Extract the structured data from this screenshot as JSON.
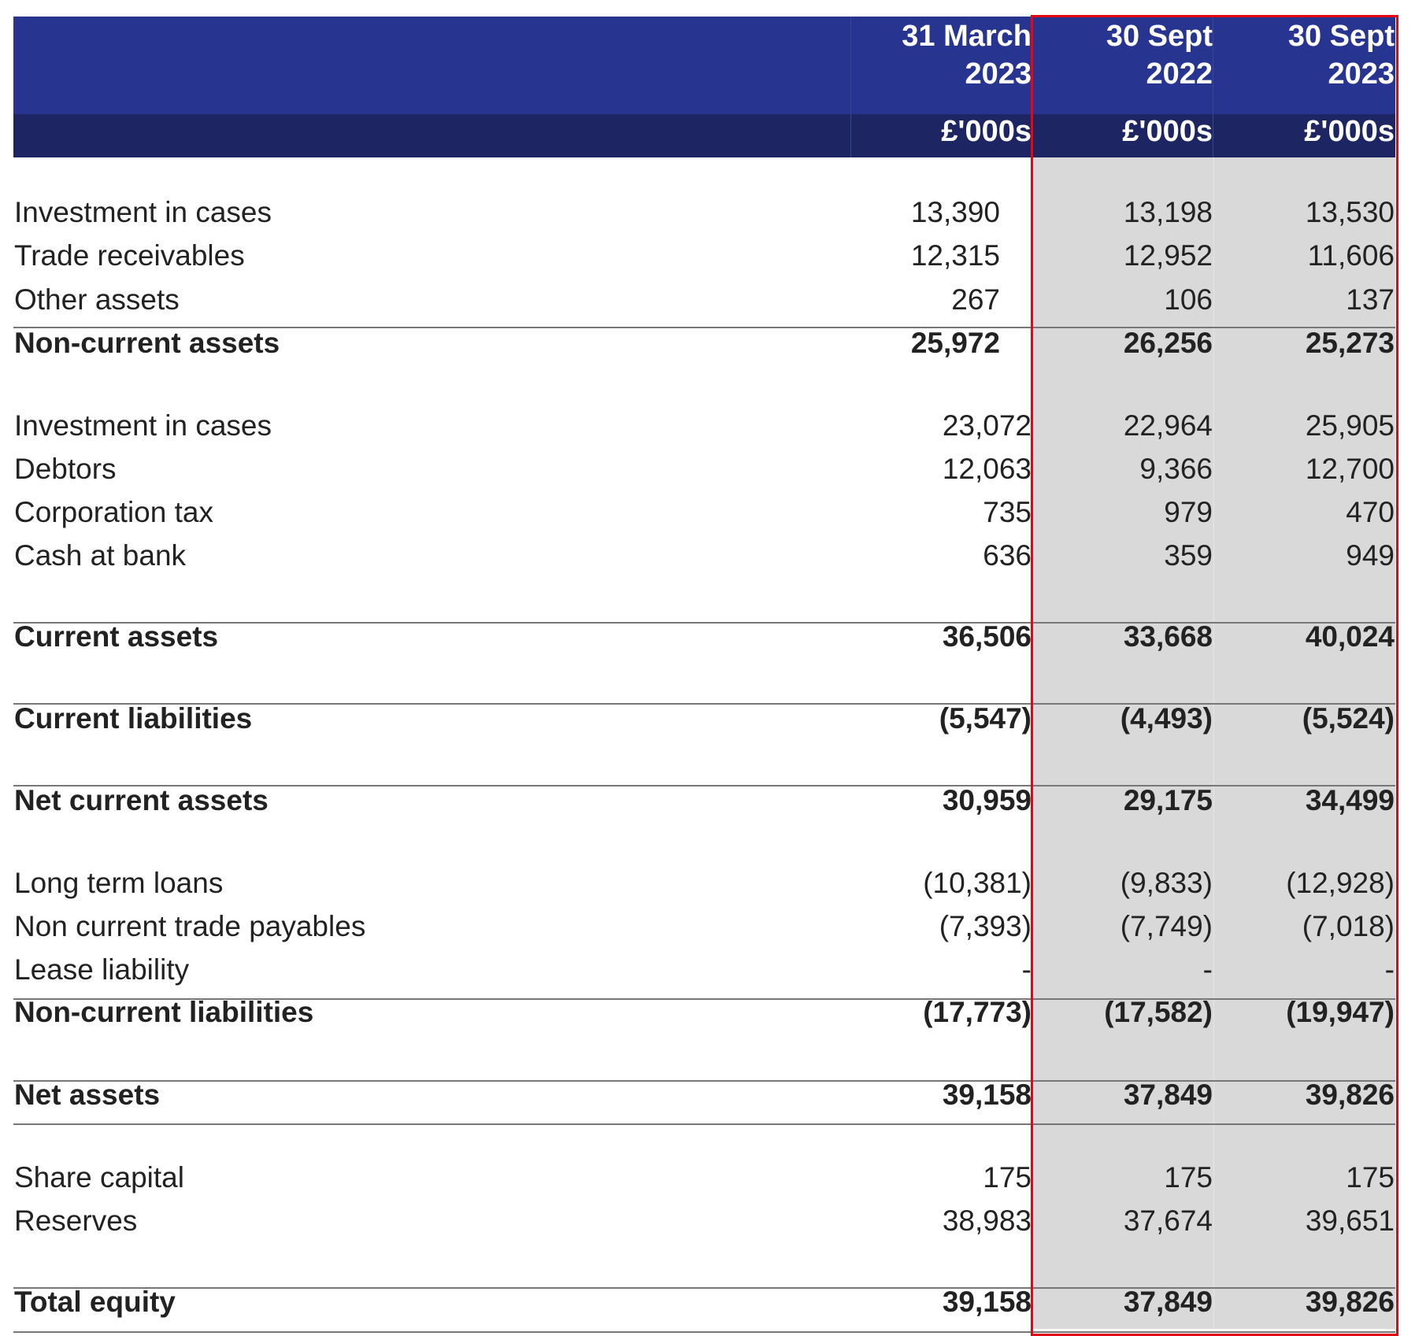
{
  "columns": [
    {
      "heading_line1": "31 March",
      "heading_line2": "2023",
      "unit": "£'000s"
    },
    {
      "heading_line1": "30 Sept",
      "heading_line2": "2022",
      "unit": "£'000s"
    },
    {
      "heading_line1": "30 Sept",
      "heading_line2": "2023",
      "unit": "£'000s"
    }
  ],
  "highlight": {
    "color": "#e30613",
    "shade_color": "#d9d9d9",
    "header_color": "#283590",
    "unit_row_color": "#1d2663"
  },
  "rows": {
    "nca_investment": {
      "label": "Investment in cases",
      "v1": "13,390",
      "v2": "13,198",
      "v3": "13,530"
    },
    "trade_receivables": {
      "label": "Trade receivables",
      "v1": "12,315",
      "v2": "12,952",
      "v3": "11,606"
    },
    "other_assets": {
      "label": "Other assets",
      "v1": "267",
      "v2": "106",
      "v3": "137"
    },
    "non_current_assets": {
      "label": "Non-current assets",
      "v1": "25,972",
      "v2": "26,256",
      "v3": "25,273"
    },
    "ca_investment": {
      "label": "Investment in cases",
      "v1": "23,072",
      "v2": "22,964",
      "v3": "25,905"
    },
    "debtors": {
      "label": "Debtors",
      "v1": "12,063",
      "v2": "9,366",
      "v3": "12,700"
    },
    "corporation_tax": {
      "label": "Corporation tax",
      "v1": "735",
      "v2": "979",
      "v3": "470"
    },
    "cash_at_bank": {
      "label": "Cash at bank",
      "v1": "636",
      "v2": "359",
      "v3": "949"
    },
    "current_assets": {
      "label": "Current assets",
      "v1": "36,506",
      "v2": "33,668",
      "v3": "40,024"
    },
    "current_liabilities": {
      "label": "Current liabilities",
      "v1": "(5,547)",
      "v2": "(4,493)",
      "v3": "(5,524)"
    },
    "net_current_assets": {
      "label": "Net current assets",
      "v1": "30,959",
      "v2": "29,175",
      "v3": "34,499"
    },
    "long_term_loans": {
      "label": "Long term loans",
      "v1": "(10,381)",
      "v2": "(9,833)",
      "v3": "(12,928)"
    },
    "non_current_trade_payables": {
      "label": "Non current trade payables",
      "v1": "(7,393)",
      "v2": "(7,749)",
      "v3": "(7,018)"
    },
    "lease_liability": {
      "label": "Lease liability",
      "v1": "-",
      "v2": "-",
      "v3": "-"
    },
    "non_current_liabilities": {
      "label": "Non-current liabilities",
      "v1": "(17,773)",
      "v2": "(17,582)",
      "v3": "(19,947)"
    },
    "net_assets": {
      "label": "Net assets",
      "v1": "39,158",
      "v2": "37,849",
      "v3": "39,826"
    },
    "share_capital": {
      "label": "Share capital",
      "v1": "175",
      "v2": "175",
      "v3": "175"
    },
    "reserves": {
      "label": "Reserves",
      "v1": "38,983",
      "v2": "37,674",
      "v3": "39,651"
    },
    "total_equity": {
      "label": "Total equity",
      "v1": "39,158",
      "v2": "37,849",
      "v3": "39,826"
    }
  }
}
